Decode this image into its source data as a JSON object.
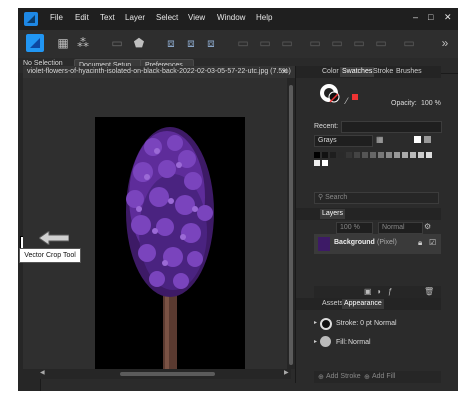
{
  "menubar": {
    "items": [
      "File",
      "Edit",
      "Text",
      "Layer",
      "Select",
      "View",
      "Window",
      "Help"
    ],
    "window_controls": [
      "–",
      "□",
      "✕"
    ]
  },
  "context_toolbar": {
    "selection": "No Selection",
    "document_setup": "Document Setup...",
    "preferences": "Preferences..."
  },
  "document": {
    "tab_title": "violet-flowers-of-hyacinth-isolated-on-black-back-2022-02-03-05-57-22-utc.jpg (7.5%)",
    "close": "✕"
  },
  "tooltip": {
    "text": "Vector Crop Tool"
  },
  "color_panel": {
    "tabs": [
      "Color",
      "Swatches",
      "Stroke",
      "Brushes"
    ],
    "selected_tab": "Swatches",
    "opacity_label": "Opacity:",
    "opacity_value": "100 %",
    "recent_label": "Recent:",
    "palette": "Grays"
  },
  "search": {
    "placeholder": "Search"
  },
  "layers_panel": {
    "tab": "Layers",
    "opacity_value": "100 %",
    "blend_mode": "Normal",
    "layer_name": "Background",
    "layer_type": "(Pixel)"
  },
  "appearance_panel": {
    "tabs": [
      "Assets",
      "Appearance"
    ],
    "selected_tab": "Appearance",
    "stroke_label": "Stroke: 0 pt",
    "stroke_mode": "Normal",
    "fill_label": "Fill:",
    "fill_mode": "Normal",
    "add_stroke": "Add Stroke",
    "add_fill": "Add Fill"
  },
  "colors": {
    "accent": "#2196f3",
    "flower": "#5e2c9a",
    "stem": "#5a3a30"
  }
}
